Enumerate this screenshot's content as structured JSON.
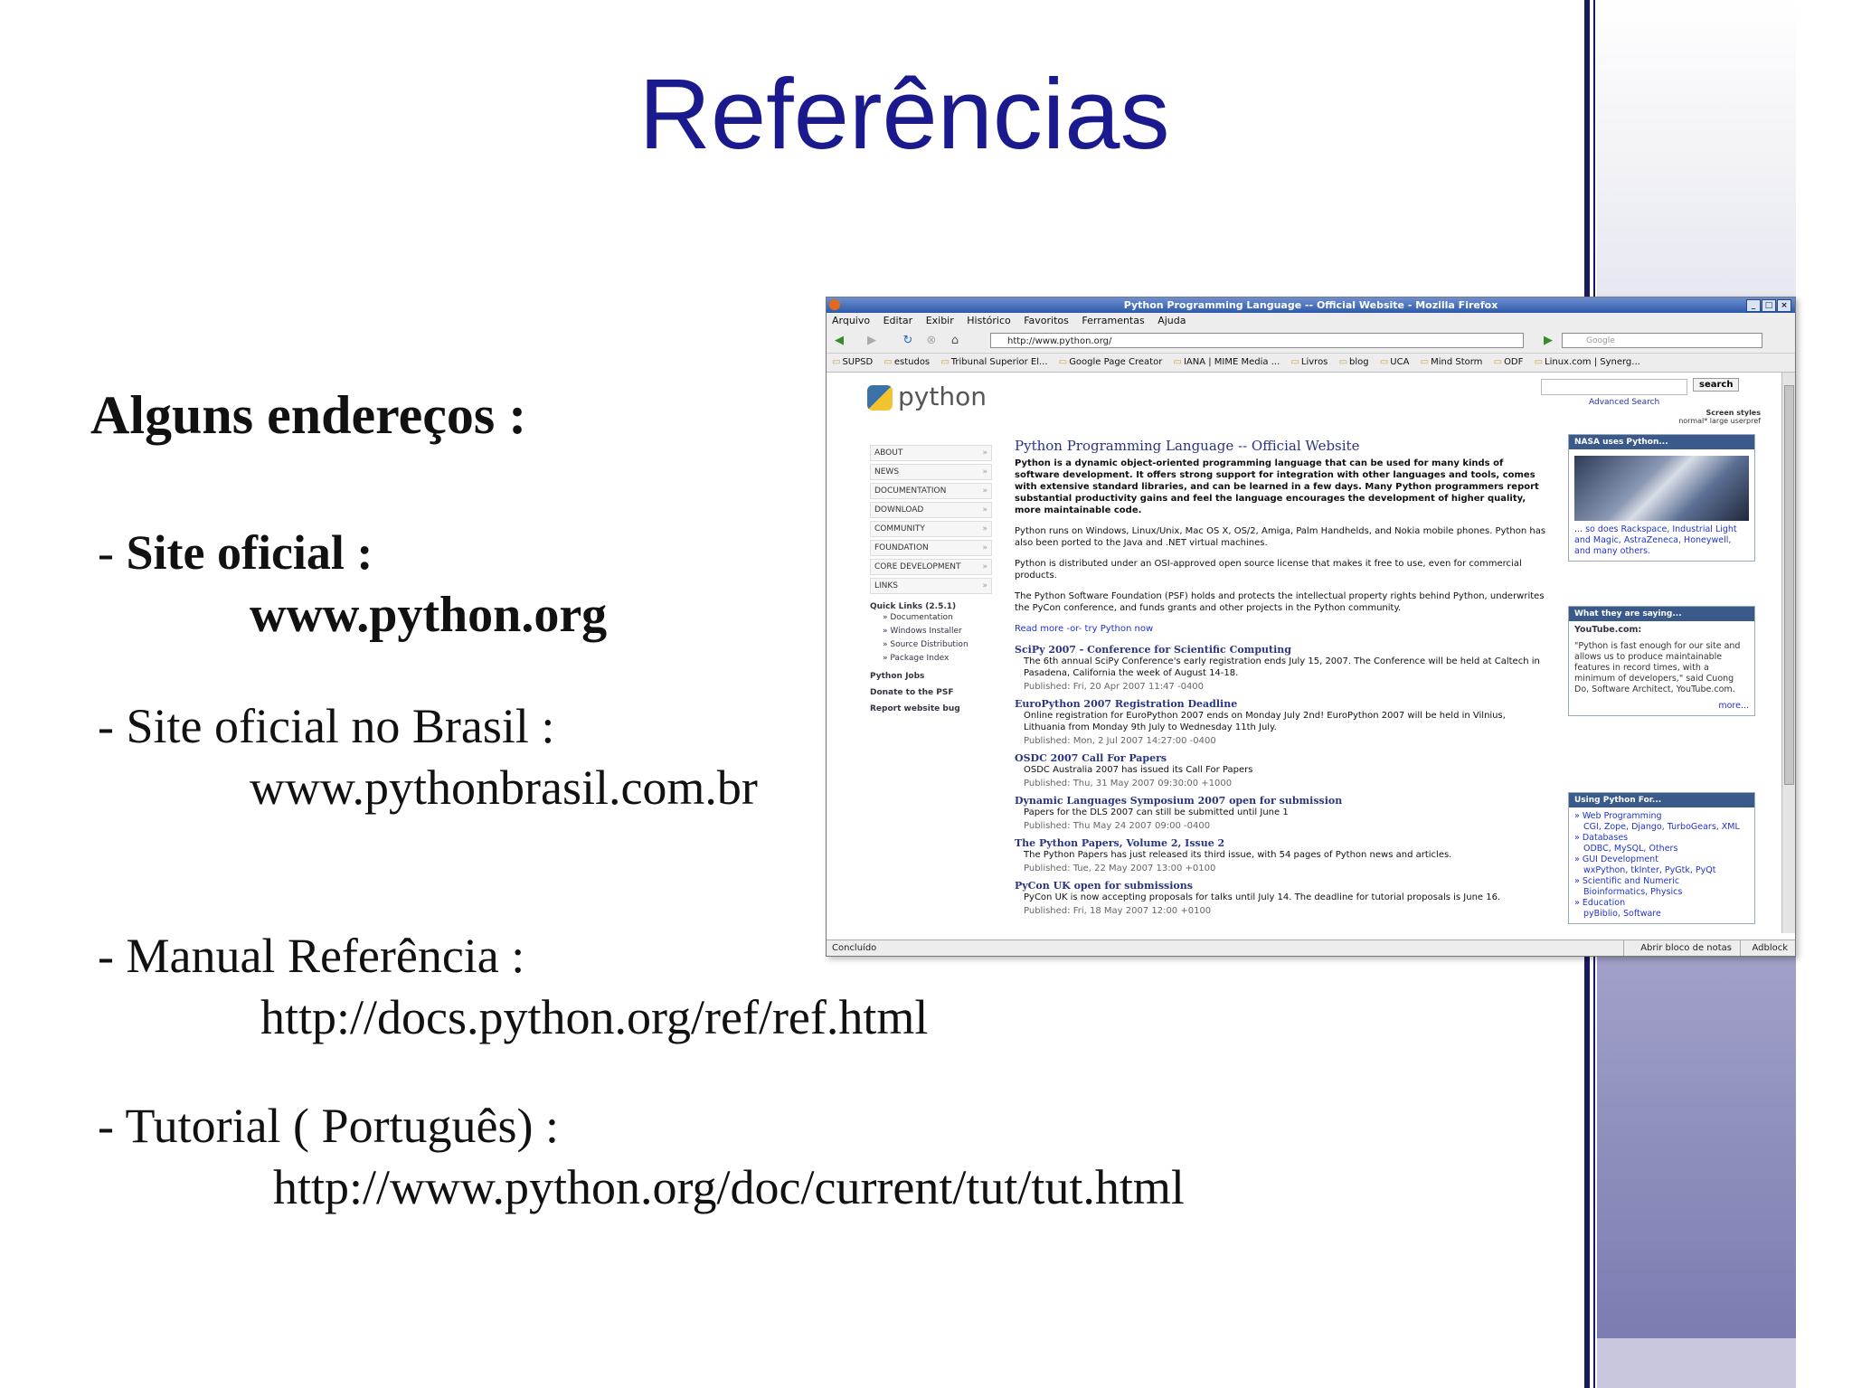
{
  "slide": {
    "title": "Referências",
    "heading": "Alguns endereços  :",
    "items": [
      {
        "prefix": "- ",
        "label": "Site oficial :",
        "url": "www.python.org"
      },
      {
        "prefix": "- ",
        "label": "Site oficial no Brasil :",
        "url": "www.pythonbrasil.com.br"
      },
      {
        "prefix": "- ",
        "label": "Manual Referência :",
        "url": "http://docs.python.org/ref/ref.html"
      },
      {
        "prefix": "- ",
        "label": "Tutorial ( Português) :",
        "url": "http://www.python.org/doc/current/tut/tut.html"
      }
    ]
  },
  "browser": {
    "window_title": "Python Programming Language -- Official Website - Mozilla Firefox",
    "menu": [
      "Arquivo",
      "Editar",
      "Exibir",
      "Histórico",
      "Favoritos",
      "Ferramentas",
      "Ajuda"
    ],
    "url": "http://www.python.org/",
    "search_placeholder": "Google",
    "bookmarks": [
      "SUPSD",
      "estudos",
      "Tribunal Superior El...",
      "Google Page Creator",
      "IANA | MIME Media ...",
      "Livros",
      "blog",
      "UCA",
      "Mind Storm",
      "ODF",
      "Linux.com | Synerg..."
    ],
    "status": "Concluído",
    "status_right": [
      "Abrir bloco de notas",
      "Adblock"
    ]
  },
  "page": {
    "logo": "python",
    "search_button": "search",
    "advanced_search": "Advanced Search",
    "screen_styles": "Screen styles",
    "styles": "normal*   large   userpref",
    "nav": [
      "About",
      "News",
      "Documentation",
      "Download",
      "Community",
      "Foundation",
      "Core Development",
      "Links"
    ],
    "quick_links_title": "Quick Links (2.5.1)",
    "quick_links": [
      "» Documentation",
      "» Windows Installer",
      "» Source Distribution",
      "» Package Index"
    ],
    "side_bottom": [
      "Python Jobs",
      "Donate to the PSF",
      "Report website bug"
    ],
    "main_title": "Python Programming Language -- Official Website",
    "intro": "Python is a dynamic object-oriented programming language that can be used for many kinds of software development. It offers strong support for integration with other languages and tools, comes with extensive standard libraries, and can be learned in a few days. Many Python programmers report substantial productivity gains and feel the language encourages the development of higher quality, more maintainable code.",
    "p1": "Python runs on Windows, Linux/Unix, Mac OS X, OS/2, Amiga, Palm Handhelds, and Nokia mobile phones. Python has also been ported to the Java and .NET virtual machines.",
    "p2": "Python is distributed under an OSI-approved open source license that makes it free to use, even for commercial products.",
    "p3": "The Python Software Foundation (PSF) holds and protects the intellectual property rights behind Python, underwrites the PyCon conference, and funds grants and other projects in the Python community.",
    "read_more": "Read more -or- try Python now",
    "news": [
      {
        "title": "SciPy 2007 - Conference for Scientific Computing",
        "body": "The 6th annual SciPy Conference's early registration ends July 15, 2007. The Conference will be held at Caltech in Pasadena, California the week of August 14-18.",
        "pub": "Published: Fri, 20 Apr 2007 11:47 -0400"
      },
      {
        "title": "EuroPython 2007 Registration Deadline",
        "body": "Online registration for EuroPython 2007 ends on Monday July 2nd! EuroPython 2007 will be held in Vilnius, Lithuania from Monday 9th July to Wednesday 11th July.",
        "pub": "Published: Mon, 2 Jul 2007 14:27:00 -0400"
      },
      {
        "title": "OSDC 2007 Call For Papers",
        "body": "OSDC Australia 2007 has issued its Call For Papers",
        "pub": "Published: Thu, 31 May 2007 09:30:00 +1000"
      },
      {
        "title": "Dynamic Languages Symposium 2007 open for submission",
        "body": "Papers for the DLS 2007 can still be submitted until June 1",
        "pub": "Published: Thu May 24 2007 09:00 -0400"
      },
      {
        "title": "The Python Papers, Volume 2, Issue 2",
        "body": "The Python Papers has just released its third issue, with 54 pages of Python news and articles.",
        "pub": "Published: Tue, 22 May 2007 13:00 +0100"
      },
      {
        "title": "PyCon UK open for submissions",
        "body": "PyCon UK is now accepting proposals for talks until July 14. The deadline for tutorial proposals is June 16.",
        "pub": "Published: Fri, 18 May 2007 12:00 +0100"
      }
    ],
    "box1_title": "NASA uses Python...",
    "box1_text": "... so does Rackspace, Industrial Light and Magic, AstraZeneca, Honeywell, and many others.",
    "box2_title": "What they are saying...",
    "box2_sub": "YouTube.com:",
    "box2_text": "\"Python is fast enough for our site and allows us to produce maintainable features in record times, with a minimum of developers,\" said Cuong Do, Software Architect, YouTube.com.",
    "box2_more": "more...",
    "box3_title": "Using Python For...",
    "box3_items": [
      "» Web Programming",
      "CGI, Zope, Django, TurboGears, XML",
      "» Databases",
      "ODBC, MySQL, Others",
      "» GUI Development",
      "wxPython, tkInter, PyGtk, PyQt",
      "» Scientific and Numeric",
      "Bioinformatics, Physics",
      "» Education",
      "pyBiblio, Software"
    ]
  }
}
